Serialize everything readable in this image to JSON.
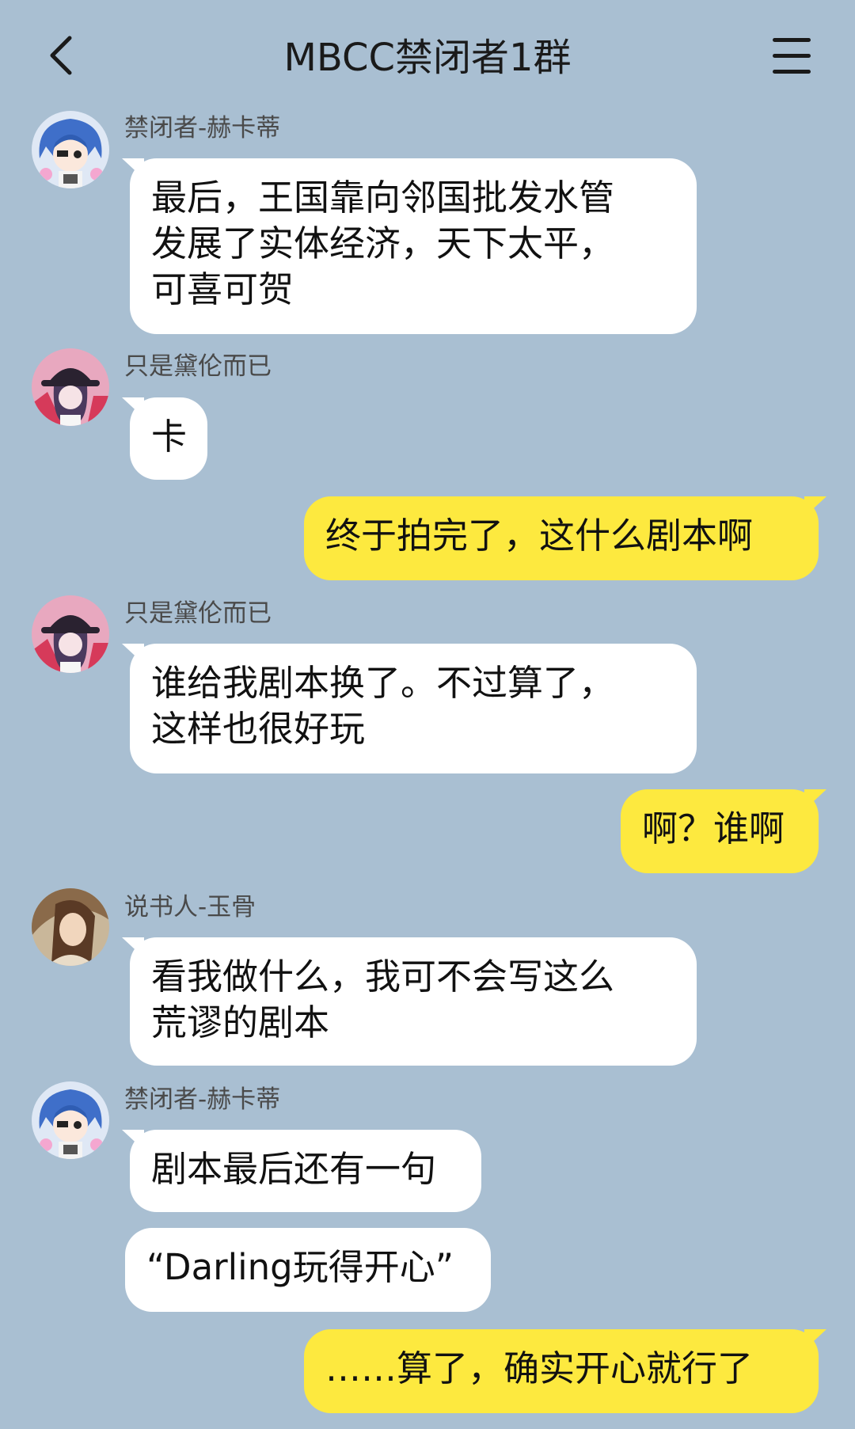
{
  "header": {
    "back_icon": "chevron-left-icon",
    "title": "MBCC禁闭者1群",
    "menu_icon": "hamburger-menu-icon"
  },
  "messages": [
    {
      "sender": "禁闭者-赫卡蒂",
      "direction": "in",
      "text": "最后，王国靠向邻国批发水管\n发展了实体经济，天下太平，\n可喜可贺"
    },
    {
      "sender": "只是黛伦而已",
      "direction": "in",
      "text": "卡"
    },
    {
      "sender": "",
      "direction": "out",
      "text": "终于拍完了，这什么剧本啊"
    },
    {
      "sender": "只是黛伦而已",
      "direction": "in",
      "text": "谁给我剧本换了。不过算了，\n这样也很好玩"
    },
    {
      "sender": "",
      "direction": "out",
      "text": "啊？谁啊"
    },
    {
      "sender": "说书人-玉骨",
      "direction": "in",
      "text": "看我做什么，我可不会写这么\n荒谬的剧本"
    },
    {
      "sender": "禁闭者-赫卡蒂",
      "direction": "in",
      "text": "剧本最后还有一句"
    },
    {
      "sender": "禁闭者-赫卡蒂",
      "direction": "in",
      "text": "“Darling玩得开心”"
    },
    {
      "sender": "",
      "direction": "out",
      "text": "……算了，确实开心就行了"
    }
  ],
  "colors": {
    "background": "#a9bfd2",
    "incoming_bubble": "#ffffff",
    "outgoing_bubble": "#fde93f",
    "title_text": "#1a1a1a",
    "sender_text": "#4a4a4a"
  }
}
